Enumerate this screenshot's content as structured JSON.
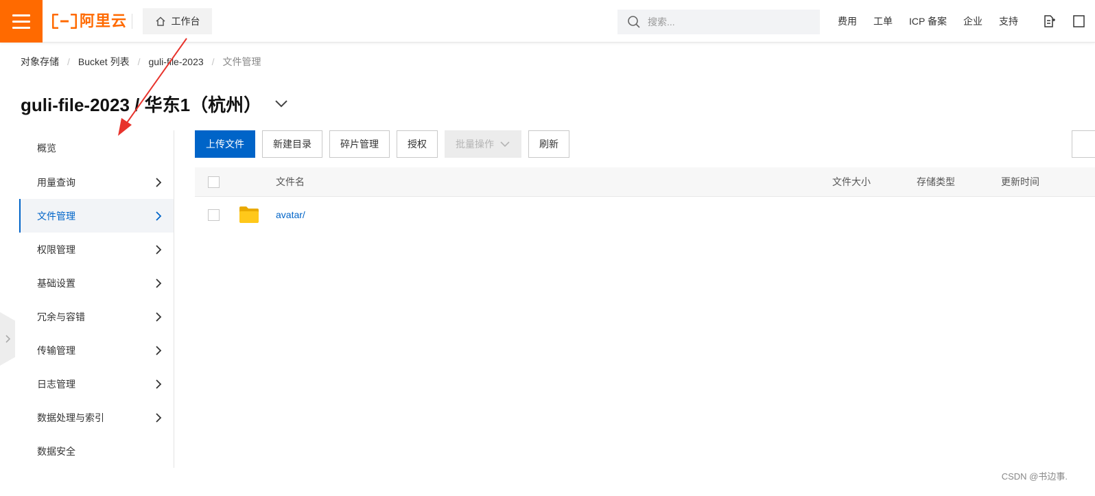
{
  "topbar": {
    "logo_text": "阿里云",
    "workbench_label": "工作台",
    "search_placeholder": "搜索...",
    "links": [
      "费用",
      "工单",
      "ICP 备案",
      "企业",
      "支持"
    ]
  },
  "breadcrumb": {
    "items": [
      "对象存储",
      "Bucket 列表",
      "guli-file-2023"
    ],
    "current": "文件管理"
  },
  "header": {
    "title": "guli-file-2023 / 华东1（杭州）"
  },
  "sidebar": {
    "items": [
      {
        "label": "概览",
        "has_chevron": false
      },
      {
        "label": "用量查询",
        "has_chevron": true
      },
      {
        "label": "文件管理",
        "has_chevron": true,
        "active": true
      },
      {
        "label": "权限管理",
        "has_chevron": true
      },
      {
        "label": "基础设置",
        "has_chevron": true
      },
      {
        "label": "冗余与容错",
        "has_chevron": true
      },
      {
        "label": "传输管理",
        "has_chevron": true
      },
      {
        "label": "日志管理",
        "has_chevron": true
      },
      {
        "label": "数据处理与索引",
        "has_chevron": true
      },
      {
        "label": "数据安全",
        "has_chevron": false
      }
    ]
  },
  "toolbar": {
    "upload_label": "上传文件",
    "new_dir_label": "新建目录",
    "fragments_label": "碎片管理",
    "authorize_label": "授权",
    "batch_label": "批量操作",
    "refresh_label": "刷新"
  },
  "table": {
    "headers": {
      "name": "文件名",
      "size": "文件大小",
      "storage_class": "存储类型",
      "updated": "更新时间"
    },
    "rows": [
      {
        "name": "avatar/",
        "type": "folder",
        "size": "",
        "storage_class": "",
        "updated": ""
      }
    ]
  },
  "watermark": "CSDN @书边事.",
  "colors": {
    "brand_orange": "#ff6a00",
    "primary_blue": "#0064c8",
    "annotation_red": "#e8332c",
    "folder_yellow": "#f5c518"
  },
  "icons": {
    "menu": "hamburger-icon",
    "home": "home-icon",
    "search": "search-icon",
    "folder": "folder-icon",
    "chevron": "chevron-right-icon"
  }
}
